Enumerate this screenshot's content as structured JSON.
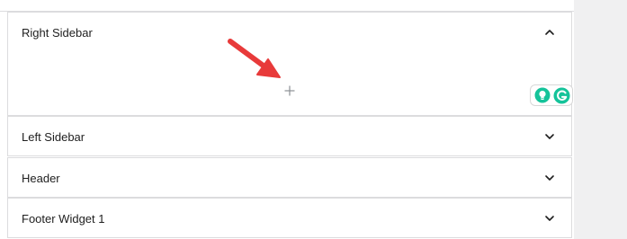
{
  "panels": [
    {
      "title": "Right Sidebar",
      "expanded": true
    },
    {
      "title": "Left Sidebar",
      "expanded": false
    },
    {
      "title": "Header",
      "expanded": false
    },
    {
      "title": "Footer Widget 1",
      "expanded": false
    }
  ],
  "icons": {
    "expanded": "chevron-up-icon",
    "collapsed": "chevron-down-icon",
    "add": "plus-icon",
    "annotation": "red-arrow-icon",
    "extension": "grammarly-icon"
  },
  "colors": {
    "annotation_arrow": "#e83a3a",
    "grammarly_green": "#15c39a",
    "border": "#dcdcde",
    "gutter": "#f0f0f1",
    "text": "#1e1e1e"
  }
}
